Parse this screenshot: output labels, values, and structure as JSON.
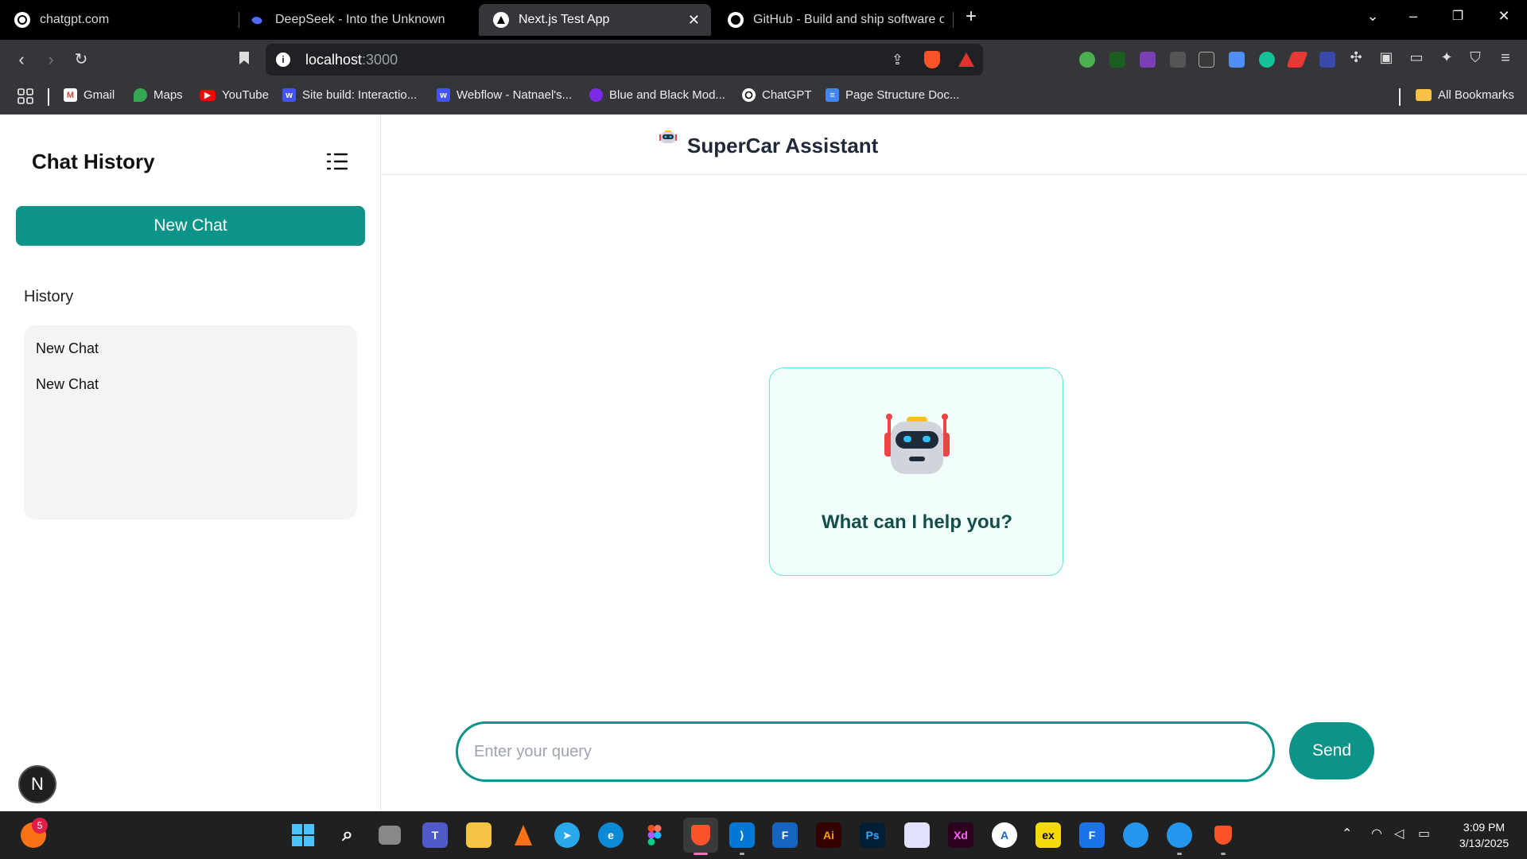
{
  "browser": {
    "tabs": [
      {
        "title": "chatgpt.com",
        "icon": "chatgpt-icon",
        "active": false
      },
      {
        "title": "DeepSeek - Into the Unknown",
        "icon": "deepseek-icon",
        "active": false
      },
      {
        "title": "Next.js Test App",
        "icon": "nextjs-icon",
        "active": true
      },
      {
        "title": "GitHub - Build and ship software on",
        "icon": "github-icon",
        "active": false
      }
    ],
    "url_host": "localhost",
    "url_port": ":3000",
    "bookmarks": [
      {
        "label": "Gmail",
        "icon": "gmail-icon",
        "color": "#ea4335"
      },
      {
        "label": "Maps",
        "icon": "maps-icon",
        "color": "#34a853"
      },
      {
        "label": "YouTube",
        "icon": "youtube-icon",
        "color": "#ff0000"
      },
      {
        "label": "Site build: Interactio...",
        "icon": "webflow-icon",
        "color": "#4353ff"
      },
      {
        "label": "Webflow - Natnael's...",
        "icon": "webflow-icon",
        "color": "#4353ff"
      },
      {
        "label": "Blue and Black Mod...",
        "icon": "canva-icon",
        "color": "#7d2ae8"
      },
      {
        "label": "ChatGPT",
        "icon": "chatgpt-icon",
        "color": "#ffffff"
      },
      {
        "label": "Page Structure Doc...",
        "icon": "docs-icon",
        "color": "#4285f4"
      }
    ],
    "all_bookmarks": "All Bookmarks"
  },
  "sidebar": {
    "title": "Chat History",
    "new_chat_label": "New Chat",
    "history_label": "History",
    "history_items": [
      "New Chat",
      "New Chat"
    ],
    "avatar_letter": "N"
  },
  "main": {
    "header_title": "SuperCar Assistant",
    "welcome_text": "What can I help you?",
    "input_placeholder": "Enter your query",
    "send_label": "Send"
  },
  "taskbar": {
    "time": "3:09 PM",
    "date": "3/13/2025",
    "notification_count": "5"
  },
  "colors": {
    "accent": "#0d9488",
    "welcome_bg": "#f0fdfa",
    "welcome_border": "#5eead4",
    "welcome_text": "#134e4a"
  }
}
